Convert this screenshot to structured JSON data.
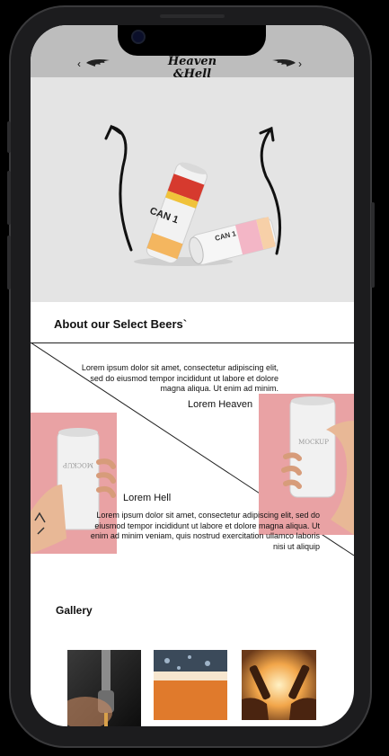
{
  "header": {
    "prev_glyph": "‹",
    "next_glyph": "›",
    "logo_line1": "Heaven",
    "logo_line2": "&Hell"
  },
  "hero": {
    "can1_label": "CAN 1",
    "can2_label": "CAN 1"
  },
  "about": {
    "title": "About our Select Beers`",
    "heaven_text": "Lorem ipsum dolor sit amet, consectetur adipiscing elit, sed do eiusmod tempor incididunt ut labore et dolore magna aliqua. Ut enim ad minim.",
    "heaven_heading": "Lorem Heaven",
    "hell_heading": "Lorem Hell",
    "hell_text": "Lorem ipsum dolor sit amet, consectetur adipiscing elit, sed do eiusmod tempor incididunt ut labore et dolore magna aliqua. Ut enim ad minim veniam, quis nostrud exercitation ullamco laboris nisi ut aliquip",
    "mockup_label": "MOCKUP"
  },
  "gallery": {
    "title": "Gallery"
  },
  "colors": {
    "header_bg": "#bdbdbd",
    "hero_bg": "#e4e4e4",
    "pink_bg": "#e9a2a4"
  }
}
